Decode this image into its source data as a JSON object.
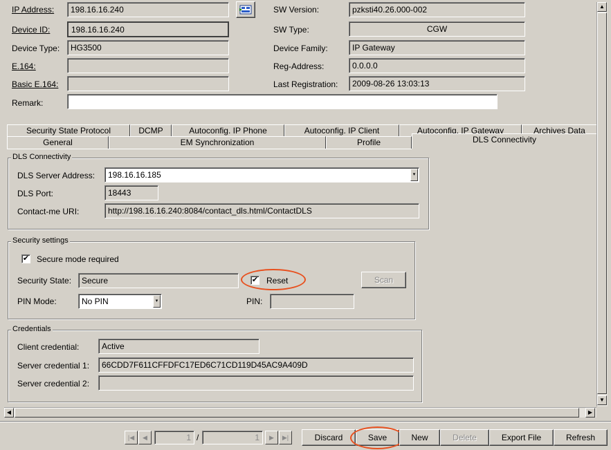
{
  "header": {
    "ip_address_label": "IP Address:",
    "ip_address_value": "198.16.16.240",
    "device_id_label": "Device ID:",
    "device_id_value": "198.16.16.240",
    "device_type_label": "Device Type:",
    "device_type_value": "HG3500",
    "e164_label": "E.164:",
    "e164_value": "",
    "basic_e164_label": "Basic E.164:",
    "basic_e164_value": "",
    "remark_label": "Remark:",
    "remark_value": "",
    "sw_version_label": "SW Version:",
    "sw_version_value": "pzksti40.26.000-002",
    "sw_type_label": "SW Type:",
    "sw_type_value": "CGW",
    "device_family_label": "Device Family:",
    "device_family_value": "IP Gateway",
    "reg_address_label": "Reg-Address:",
    "reg_address_value": "0.0.0.0",
    "last_registration_label": "Last Registration:",
    "last_registration_value": "2009-08-26 13:03:13"
  },
  "tabs": {
    "row1": [
      "Security State Protocol",
      "DCMP",
      "Autoconfig. IP Phone",
      "Autoconfig. IP Client",
      "Autoconfig. IP Gateway",
      "Archives Data"
    ],
    "row2": [
      "General",
      "EM Synchronization",
      "Profile",
      "DLS Connectivity"
    ],
    "active": "DLS Connectivity"
  },
  "dls": {
    "title": "DLS Connectivity",
    "server_label": "DLS Server Address:",
    "server_value": "198.16.16.185",
    "port_label": "DLS Port:",
    "port_value": "18443",
    "uri_label": "Contact-me URI:",
    "uri_value": "http://198.16.16.240:8084/contact_dls.html/ContactDLS"
  },
  "security": {
    "title": "Security settings",
    "secure_mode_label": "Secure mode required",
    "secure_mode_checked": true,
    "state_label": "Security State:",
    "state_value": "Secure",
    "reset_label": "Reset",
    "reset_checked": true,
    "scan_label": "Scan",
    "pin_mode_label": "PIN Mode:",
    "pin_mode_value": "No PIN",
    "pin_label": "PIN:",
    "pin_value": ""
  },
  "credentials": {
    "title": "Credentials",
    "client_label": "Client credential:",
    "client_value": "Active",
    "server1_label": "Server credential 1:",
    "server1_value": "66CDD7F611CFFDFC17ED6C71CD119D45AC9A409D",
    "server2_label": "Server credential 2:",
    "server2_value": ""
  },
  "footer": {
    "page_current": "1",
    "page_separator": "/",
    "page_total": "1",
    "discard": "Discard",
    "save": "Save",
    "new": "New",
    "delete": "Delete",
    "export": "Export File",
    "refresh": "Refresh"
  },
  "colors": {
    "background": "#d4d0c8",
    "highlight": "#e8501e"
  }
}
